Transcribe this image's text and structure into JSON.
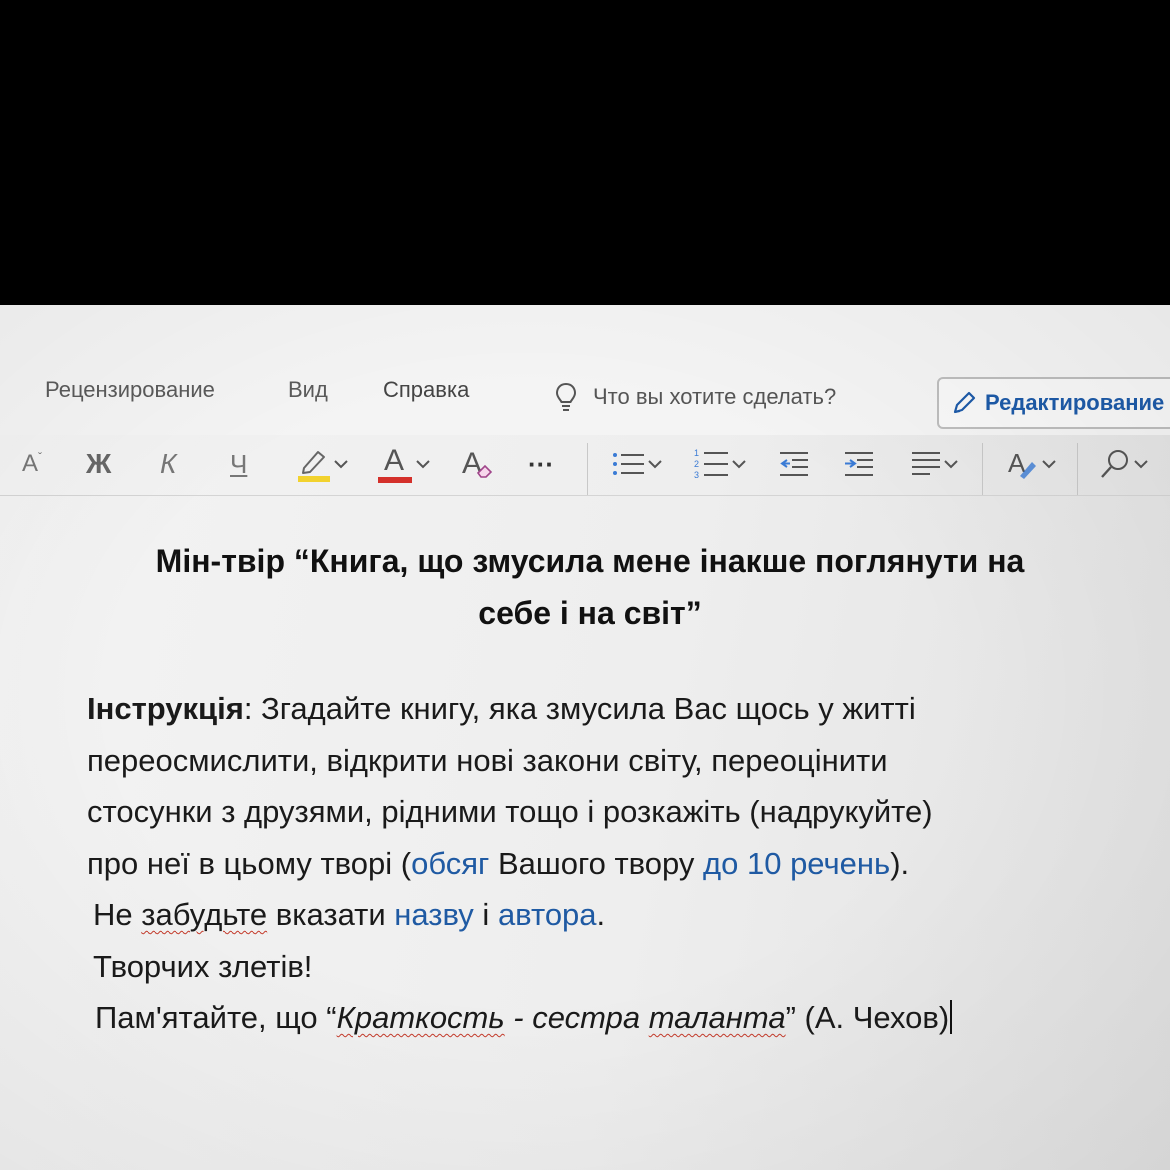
{
  "ribbon": {
    "tabs": [
      {
        "label": "Рецензирование"
      },
      {
        "label": "Вид"
      },
      {
        "label": "Справка"
      }
    ],
    "tell_me_placeholder": "Что вы хотите сделать?",
    "editing_mode_label": "Редактирование"
  },
  "toolbar": {
    "font_size_label": "A",
    "bold_label": "Ж",
    "italic_label": "К",
    "underline_label": "Ч",
    "font_color_label": "A",
    "clear_format_label": "A",
    "more_label": "···",
    "highlight_color": "#f2d22e",
    "font_color": "#d4302b",
    "icons": [
      "highlighter-icon",
      "bullets-icon",
      "numbering-icon",
      "decrease-indent-icon",
      "increase-indent-icon",
      "align-icon",
      "styles-icon",
      "search-icon",
      "chevron-down-icon"
    ]
  },
  "document": {
    "title_line1": "Мін-твір “Книга, що змусила мене інакше поглянути на",
    "title_line2": "себе і на світ”",
    "l1_label": "Інструкція",
    "l1_text": ": Згадайте книгу, яка змусила Вас щось у житті",
    "l2": "переосмислити, відкрити нові закони світу, переоцінити",
    "l3": "стосунки з друзями, рідними тощо і розкажіть (надрукуйте)",
    "l4_a": "про неї в цьому творі (",
    "l4_b": "обсяг",
    "l4_c": " Вашого твору ",
    "l4_d": "до 10 речень",
    "l4_e": ").",
    "l5_a": "Не ",
    "l5_b": "забудьте",
    "l5_c": " вказати ",
    "l5_d": "назву",
    "l5_e": " і ",
    "l5_f": "автора",
    "l5_g": ".",
    "l6": "Творчих злетів!",
    "l7_a": "Пам'ятайте, що “",
    "l7_b": "Краткость",
    "l7_c": " - сестра ",
    "l7_d": "таланта",
    "l7_e": "” (А. Чехов)"
  }
}
